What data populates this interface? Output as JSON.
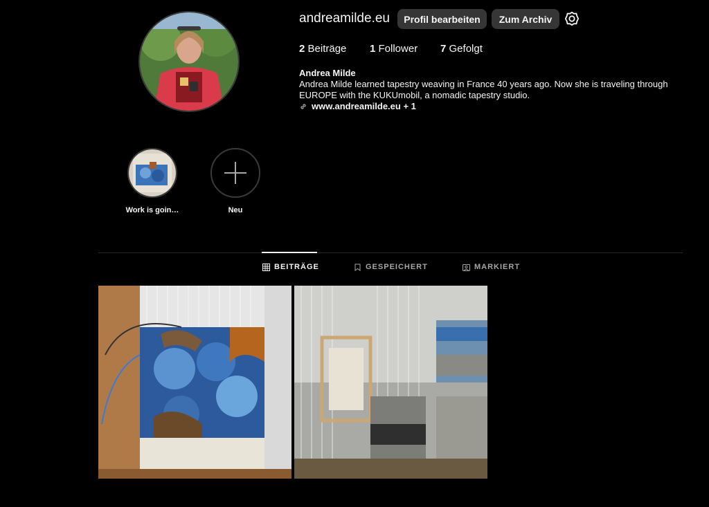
{
  "profile": {
    "username": "andreamilde.eu",
    "edit_label": "Profil bearbeiten",
    "archive_label": "Zum Archiv",
    "stats": [
      {
        "count": "2",
        "label": "Beiträge"
      },
      {
        "count": "1",
        "label": "Follower"
      },
      {
        "count": "7",
        "label": "Gefolgt"
      }
    ],
    "name": "Andrea Milde",
    "bio_line1": "Andrea Milde learned tapestry weaving in France 40 years ago. Now she is traveling through",
    "bio_line2": "EUROPE with the KUKUmobil, a nomadic tapestry studio.",
    "link": "www.andreamilde.eu + 1"
  },
  "highlights": [
    {
      "label": "Work is goin…"
    },
    {
      "label": "Neu"
    }
  ],
  "tabs": [
    {
      "label": "BEITRÄGE",
      "active": true
    },
    {
      "label": "GESPEICHERT",
      "active": false
    },
    {
      "label": "MARKIERT",
      "active": false
    }
  ],
  "colors": {
    "background": "#000000",
    "button": "#363636",
    "text": "#f5f5f5",
    "muted": "#a8a8a8"
  }
}
